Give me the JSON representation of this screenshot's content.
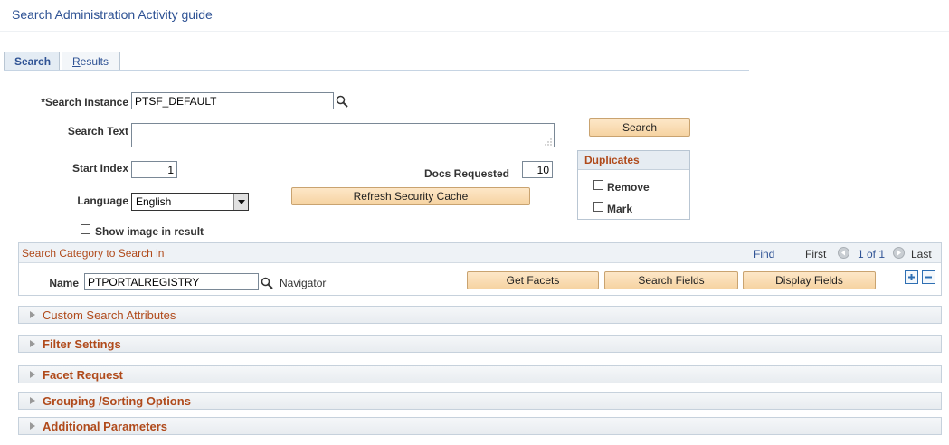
{
  "page": {
    "title": "Search Administration Activity guide"
  },
  "tabs": [
    {
      "label": "Search",
      "active": true
    },
    {
      "label_first": "R",
      "label_rest": "esults",
      "active": false
    }
  ],
  "form": {
    "search_instance": {
      "label": "*Search Instance",
      "value": "PTSF_DEFAULT"
    },
    "search_text": {
      "label": "Search Text",
      "value": ""
    },
    "start_index": {
      "label": "Start Index",
      "value": "1"
    },
    "docs_requested": {
      "label": "Docs Requested",
      "value": "10"
    },
    "language": {
      "label": "Language",
      "selected": "English"
    },
    "show_image": {
      "label": "Show image in result",
      "checked": false
    }
  },
  "buttons": {
    "search": "Search",
    "refresh_security_cache": "Refresh Security Cache",
    "get_facets": "Get Facets",
    "search_fields": "Search Fields",
    "display_fields": "Display Fields"
  },
  "duplicates": {
    "title": "Duplicates",
    "remove": {
      "label": "Remove",
      "checked": false
    },
    "mark": {
      "label": "Mark",
      "checked": false
    }
  },
  "category_grid": {
    "title": "Search Category to Search in",
    "find": "Find",
    "first": "First",
    "count": "1 of 1",
    "last": "Last",
    "row": {
      "name_label": "Name",
      "name_value": "PTPORTALREGISTRY",
      "navigator": "Navigator"
    }
  },
  "sections": [
    {
      "label": "Custom Search Attributes",
      "bold": false
    },
    {
      "label": "Filter Settings",
      "bold": true
    },
    {
      "label": "Facet Request",
      "bold": true
    },
    {
      "label": "Grouping /Sorting Options",
      "bold": true
    },
    {
      "label": "Additional Parameters",
      "bold": true
    }
  ],
  "colors": {
    "title": "#2e5294",
    "section_label": "#b04a1b",
    "button_bg": "#f6d3a2"
  }
}
